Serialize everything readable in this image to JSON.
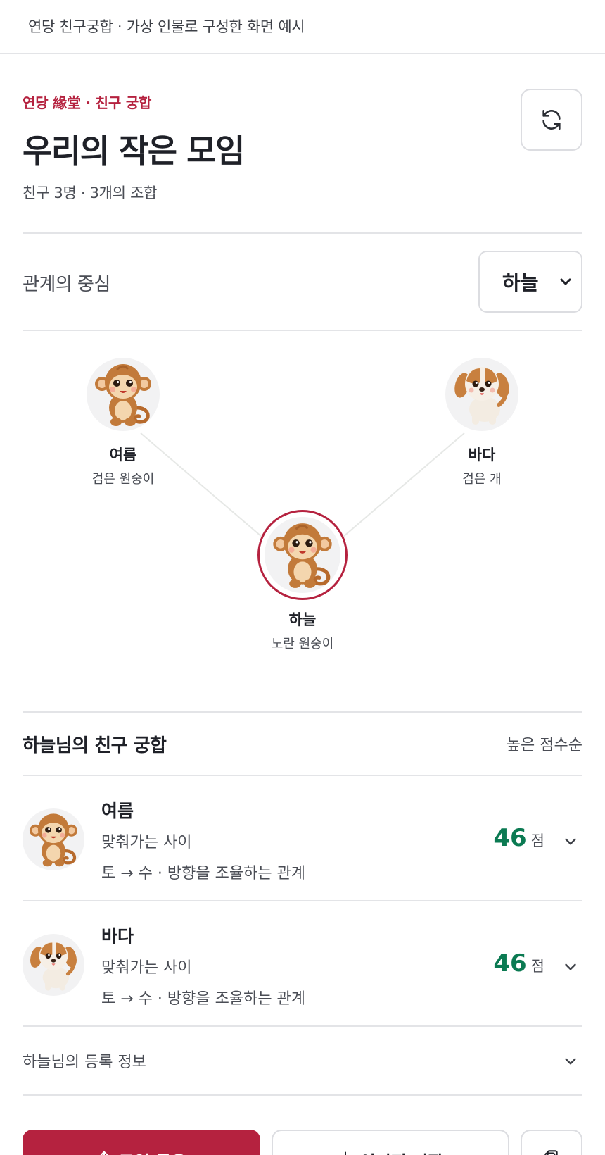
{
  "topbar": {
    "text": "연당 친구궁합 · 가상 인물로 구성한 화면 예시"
  },
  "header": {
    "eyebrow": "연당 緣堂 · 친구 궁합",
    "title": "우리의 작은 모임",
    "subtitle": "친구 3명 · 3개의 조합"
  },
  "center_selector": {
    "label": "관계의 중심",
    "selected": "하늘"
  },
  "network": {
    "center": {
      "name": "하늘",
      "sub": "노란 원숭이",
      "animal": "monkey"
    },
    "others": [
      {
        "name": "여름",
        "sub": "검은 원숭이",
        "animal": "monkey"
      },
      {
        "name": "바다",
        "sub": "검은 개",
        "animal": "dog"
      }
    ]
  },
  "matches": {
    "title": "하늘님의 친구 궁합",
    "sort": "높은 점수순",
    "items": [
      {
        "name": "여름",
        "relation": "맞춰가는 사이",
        "desc": "토 → 수 · 방향을 조율하는 관계",
        "score": "46",
        "unit": "점",
        "animal": "monkey"
      },
      {
        "name": "바다",
        "relation": "맞춰가는 사이",
        "desc": "토 → 수 · 방향을 조율하는 관계",
        "score": "46",
        "unit": "점",
        "animal": "dog"
      }
    ]
  },
  "info": {
    "label": "하늘님의 등록 정보"
  },
  "actions": {
    "share": "모임 공유",
    "save": "이미지 저장"
  },
  "colors": {
    "accent": "#b5223f",
    "score": "#0b7a52",
    "border": "#dcdde1"
  }
}
